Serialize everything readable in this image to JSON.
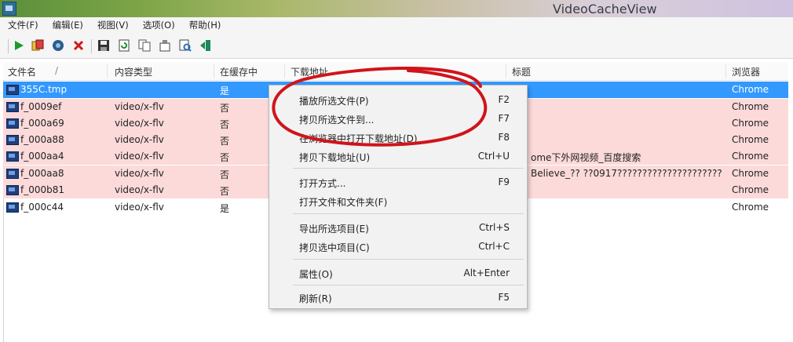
{
  "window": {
    "title": "VideoCacheView"
  },
  "menu": [
    "文件(F)",
    "编辑(E)",
    "视图(V)",
    "选项(O)",
    "帮助(H)"
  ],
  "toolbar": {
    "icons": [
      "play-icon",
      "copy-files-icon",
      "open-folder-icon",
      "delete-icon",
      "save-icon",
      "refresh-icon",
      "copy-icon",
      "properties-icon",
      "find-icon",
      "exit-icon"
    ]
  },
  "columns": [
    "文件名",
    "内容类型",
    "在缓存中",
    "下载地址",
    "标题",
    "浏览器"
  ],
  "sort_indicator": "/",
  "rows": [
    {
      "name": "355C.tmp",
      "type": "",
      "cached": "是",
      "url": "",
      "title": "",
      "browser": "Chrome"
    },
    {
      "name": "f_0009ef",
      "type": "video/x-flv",
      "cached": "否",
      "url": "",
      "title": "",
      "browser": "Chrome"
    },
    {
      "name": "f_000a69",
      "type": "video/x-flv",
      "cached": "否",
      "url": "",
      "title": "",
      "browser": "Chrome"
    },
    {
      "name": "f_000a88",
      "type": "video/x-flv",
      "cached": "否",
      "url": "",
      "title": "",
      "browser": "Chrome"
    },
    {
      "name": "f_000aa4",
      "type": "video/x-flv",
      "cached": "否",
      "url": "",
      "title": "ome下外网视频_百度搜索",
      "browser": "Chrome"
    },
    {
      "name": "f_000aa8",
      "type": "video/x-flv",
      "cached": "否",
      "url": "",
      "title": "Believe_?? ??0917?????????????????????...",
      "browser": "Chrome"
    },
    {
      "name": "f_000b81",
      "type": "video/x-flv",
      "cached": "否",
      "url": "",
      "title": "",
      "browser": "Chrome"
    },
    {
      "name": "f_000c44",
      "type": "video/x-flv",
      "cached": "是",
      "url": "",
      "title": "",
      "browser": "Chrome"
    }
  ],
  "context_menu": [
    {
      "label": "播放所选文件(P)",
      "shortcut": "F2"
    },
    {
      "label": "拷贝所选文件到...",
      "shortcut": "F7"
    },
    {
      "label": "在浏览器中打开下载地址(D)",
      "shortcut": "F8"
    },
    {
      "label": "拷贝下载地址(U)",
      "shortcut": "Ctrl+U"
    },
    {
      "label": "打开方式...",
      "shortcut": "F9"
    },
    {
      "label": "打开文件和文件夹(F)",
      "shortcut": ""
    },
    {
      "label": "导出所选项目(E)",
      "shortcut": "Ctrl+S"
    },
    {
      "label": "拷贝选中项目(C)",
      "shortcut": "Ctrl+C"
    },
    {
      "label": "属性(O)",
      "shortcut": "Alt+Enter"
    },
    {
      "label": "刷新(R)",
      "shortcut": "F5"
    }
  ],
  "colors": {
    "selected_row": "#3399ff",
    "highlight_row": "#fcdada",
    "annotation": "#d0141a"
  }
}
